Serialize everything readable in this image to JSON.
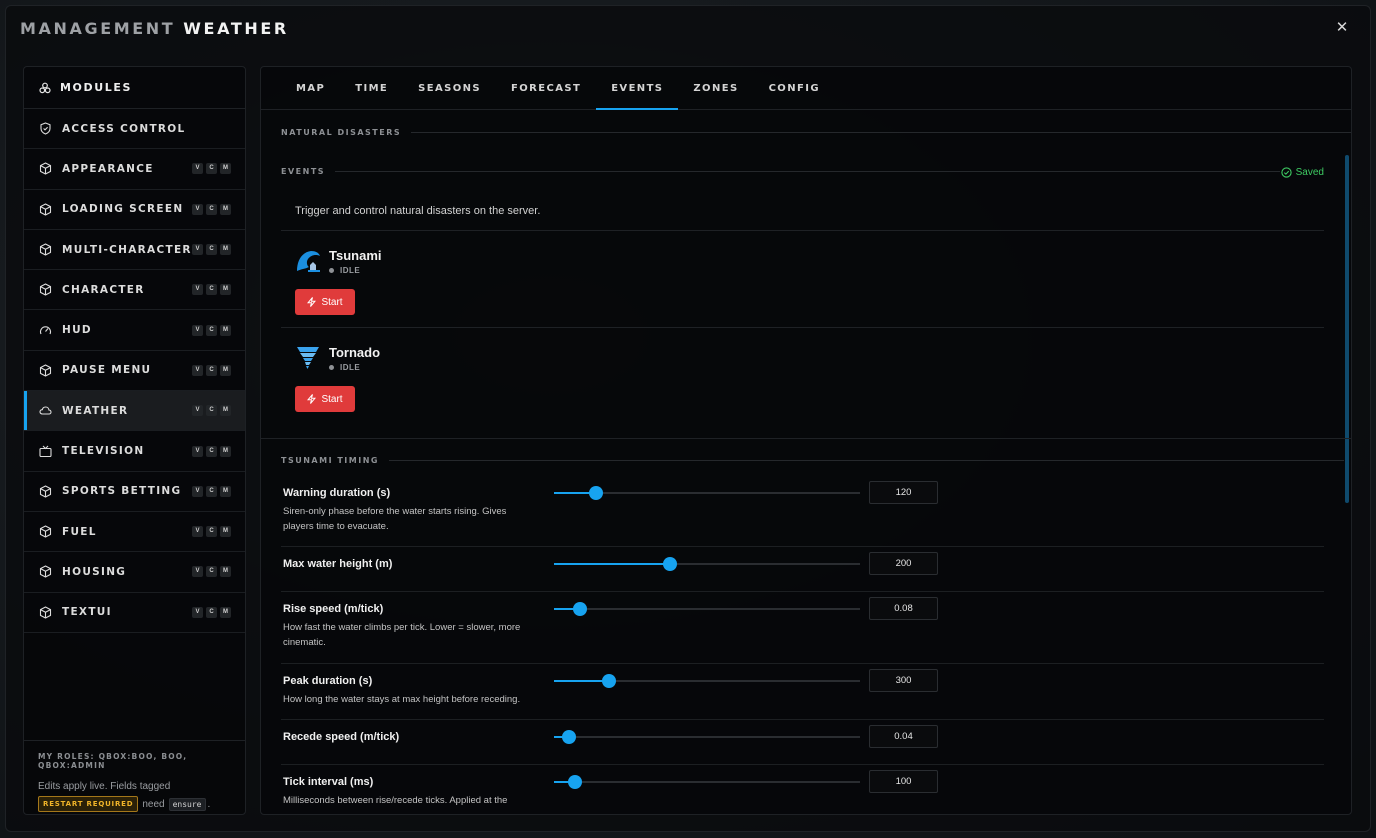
{
  "app": {
    "title": "MANAGEMENT",
    "subtitle": "WEATHER",
    "close_icon": "close-icon"
  },
  "sidebar": {
    "header": "MODULES",
    "items": [
      {
        "label": "ACCESS CONTROL",
        "icon": "shield-icon",
        "tags": []
      },
      {
        "label": "APPEARANCE",
        "icon": "cube-icon",
        "tags": [
          "V",
          "C",
          "M"
        ]
      },
      {
        "label": "LOADING SCREEN",
        "icon": "cube-icon",
        "tags": [
          "V",
          "C",
          "M"
        ]
      },
      {
        "label": "MULTI-CHARACTER",
        "icon": "cube-icon",
        "tags": [
          "V",
          "C",
          "M"
        ]
      },
      {
        "label": "CHARACTER",
        "icon": "cube-icon",
        "tags": [
          "V",
          "C",
          "M"
        ]
      },
      {
        "label": "HUD",
        "icon": "gauge-icon",
        "tags": [
          "V",
          "C",
          "M"
        ]
      },
      {
        "label": "PAUSE MENU",
        "icon": "cube-icon",
        "tags": [
          "V",
          "C",
          "M"
        ]
      },
      {
        "label": "WEATHER",
        "icon": "cloud-icon",
        "tags": [
          "V",
          "C",
          "M"
        ],
        "active": true
      },
      {
        "label": "TELEVISION",
        "icon": "tv-icon",
        "tags": [
          "V",
          "C",
          "M"
        ]
      },
      {
        "label": "SPORTS BETTING",
        "icon": "cube-icon",
        "tags": [
          "V",
          "C",
          "M"
        ]
      },
      {
        "label": "FUEL",
        "icon": "cube-icon",
        "tags": [
          "V",
          "C",
          "M"
        ]
      },
      {
        "label": "HOUSING",
        "icon": "cube-icon",
        "tags": [
          "V",
          "C",
          "M"
        ]
      },
      {
        "label": "TEXTUI",
        "icon": "cube-icon",
        "tags": [
          "V",
          "C",
          "M"
        ]
      }
    ],
    "footer": {
      "roles": "MY ROLES: QBOX:BOO, BOO, QBOX:ADMIN",
      "edits_line": "Edits apply live. Fields tagged",
      "restart_badge": "RESTART REQUIRED",
      "need": "need",
      "code": "ensure",
      "period": "."
    }
  },
  "tabs": [
    {
      "label": "MAP"
    },
    {
      "label": "TIME"
    },
    {
      "label": "SEASONS"
    },
    {
      "label": "FORECAST"
    },
    {
      "label": "EVENTS",
      "active": true
    },
    {
      "label": "ZONES"
    },
    {
      "label": "CONFIG"
    }
  ],
  "events": {
    "section_title": "NATURAL DISASTERS",
    "sub_title": "EVENTS",
    "saved_label": "Saved",
    "description": "Trigger and control natural disasters on the server.",
    "disasters": [
      {
        "name": "Tsunami",
        "status": "IDLE",
        "button": "Start",
        "icon": "tsunami-icon"
      },
      {
        "name": "Tornado",
        "status": "IDLE",
        "button": "Start",
        "icon": "tornado-icon"
      }
    ]
  },
  "timing": {
    "section_title": "TSUNAMI TIMING",
    "rows": [
      {
        "label": "Warning duration (s)",
        "desc": "Siren-only phase before the water starts rising. Gives players time to evacuate.",
        "value": "120",
        "fraction": 0.137
      },
      {
        "label": "Max water height (m)",
        "desc": "",
        "value": "200",
        "fraction": 0.379
      },
      {
        "label": "Rise speed (m/tick)",
        "desc": "How fast the water climbs per tick. Lower = slower, more cinematic.",
        "value": "0.08",
        "fraction": 0.085
      },
      {
        "label": "Peak duration (s)",
        "desc": "How long the water stays at max height before receding.",
        "value": "300",
        "fraction": 0.179
      },
      {
        "label": "Recede speed (m/tick)",
        "desc": "",
        "value": "0.04",
        "fraction": 0.049
      },
      {
        "label": "Tick interval (ms)",
        "desc": "Milliseconds between rise/recede ticks. Applied at the",
        "value": "100",
        "fraction": 0.069
      }
    ]
  },
  "colors": {
    "accent": "#17a3f0",
    "danger": "#e03b3b",
    "success": "#3ecb63",
    "warning": "#f0b429"
  }
}
